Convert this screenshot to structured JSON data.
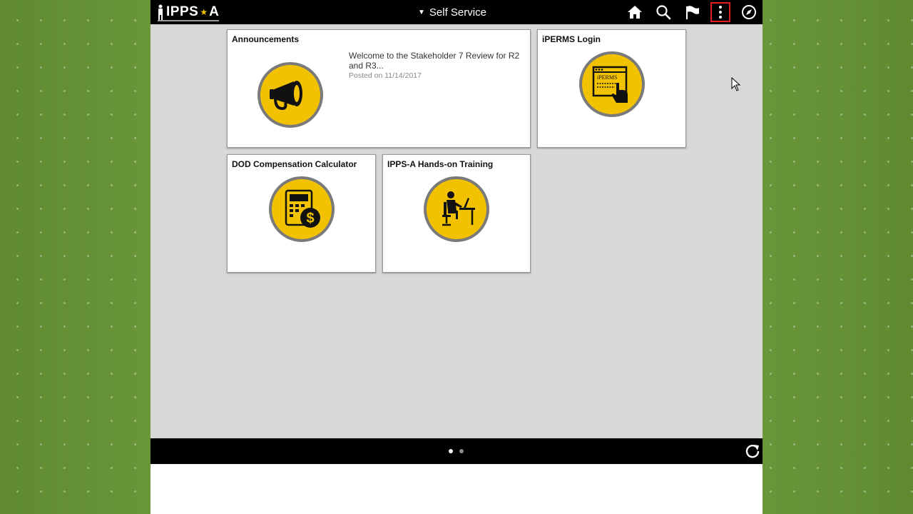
{
  "header": {
    "logo_text": "IPPS",
    "logo_text_b": "A",
    "title": "Self Service",
    "icons": [
      "home-icon",
      "search-icon",
      "flag-icon",
      "more-vertical-icon",
      "compass-icon"
    ]
  },
  "tiles": {
    "announcements": {
      "title": "Announcements",
      "message": "Welcome to the Stakeholder 7 Review for R2 and R3...",
      "posted": "Posted on 11/14/2017",
      "icon": "megaphone-icon"
    },
    "iperms": {
      "title": "iPERMS Login",
      "icon_label": "iPERMS",
      "icon": "iperms-icon"
    },
    "dod": {
      "title": "DOD Compensation Calculator",
      "icon": "calculator-dollar-icon"
    },
    "training": {
      "title": "IPPS-A Hands-on Training",
      "icon": "person-at-desk-icon"
    }
  },
  "footer": {
    "page_dots": 2,
    "active_page": 1,
    "icons": [
      "refresh-icon"
    ]
  },
  "colors": {
    "badge_fill": "#f2c200",
    "badge_border": "#7a7a7a",
    "bar": "#000000",
    "content_bg": "#d8d8d8",
    "highlight": "#e02020"
  }
}
